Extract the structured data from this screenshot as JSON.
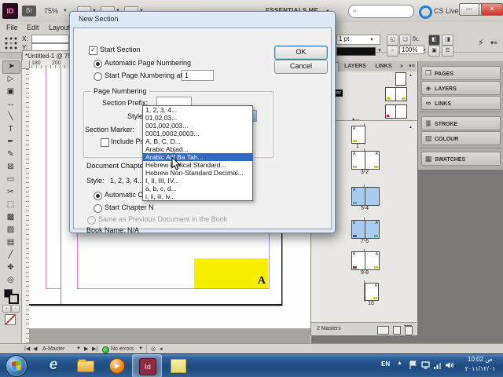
{
  "window": {
    "app_badge": "ID",
    "bridge_badge": "Br",
    "zoom_level": "75%",
    "workspace": "ESSENTIALS ME",
    "cs_live": "CS Live",
    "menus": [
      "File",
      "Edit",
      "Layout"
    ],
    "document_tab": "*Untitled-1 @ 75",
    "control": {
      "x_label": "X:",
      "y_label": "Y:",
      "stroke_weight": "1 pt",
      "fx_label": "fx.",
      "opacity": "100%"
    }
  },
  "toolbar": {
    "tools": [
      {
        "name": "selection-tool",
        "glyph": "➤"
      },
      {
        "name": "direct-selection-tool",
        "glyph": "▷"
      },
      {
        "name": "page-tool",
        "glyph": "▣"
      },
      {
        "name": "gap-tool",
        "glyph": "↔"
      },
      {
        "name": "line-tool",
        "glyph": "╲"
      },
      {
        "name": "type-tool",
        "glyph": "T"
      },
      {
        "name": "pen-tool",
        "glyph": "✒"
      },
      {
        "name": "pencil-tool",
        "glyph": "✎"
      },
      {
        "name": "frame-tool",
        "glyph": "⊠"
      },
      {
        "name": "rectangle-tool",
        "glyph": "▭"
      },
      {
        "name": "scissors-tool",
        "glyph": "✂"
      },
      {
        "name": "free-transform-tool",
        "glyph": "⬚"
      },
      {
        "name": "gradient-tool",
        "glyph": "▩"
      },
      {
        "name": "gradient-feather-tool",
        "glyph": "▨"
      },
      {
        "name": "note-tool",
        "glyph": "▤"
      },
      {
        "name": "eyedropper-tool",
        "glyph": "╱"
      },
      {
        "name": "hand-tool",
        "glyph": "✥"
      },
      {
        "name": "zoom-tool",
        "glyph": "◎"
      }
    ]
  },
  "ruler": {
    "h_numbers": [
      "180",
      "200"
    ]
  },
  "canvas": {
    "frame_letter": "A",
    "frame_color": "#f7ef00"
  },
  "dialog": {
    "title": "New Section",
    "ok": "OK",
    "cancel": "Cancel",
    "start_section": "Start Section",
    "automatic_page_numbering": "Automatic Page Numbering",
    "start_page_numbering_at": "Start Page Numbering at:",
    "start_page_value": "1",
    "page_numbering_group": "Page Numbering",
    "section_prefix": "Section Prefix:",
    "style_label": "Style:",
    "style_value": "1, 2, 3, 4...",
    "section_marker": "Section Marker:",
    "include_prefix": "Include Prefix",
    "document_chapter": "Document Chapter",
    "chapter_style_label": "Style:",
    "chapter_style_value": "1, 2, 3, 4...",
    "automatic_chapter": "Automatic Chap",
    "start_chapter": "Start Chapter N",
    "same_as_previous": "Same as Previous Document in the Book",
    "book_name": "Book Name: N/A"
  },
  "style_dropdown": {
    "highlight_color": "#316ac5",
    "selected": "Arabic Alif Ba Tah...",
    "items": [
      "1, 2, 3, 4...",
      "01,02,03...",
      "001,002,003...",
      "0001,0002,0003...",
      "A, B, C, D...",
      "Arabic Abjad...",
      "Arabic Alif Ba Tah...",
      "Hebrew Biblical Standard...",
      "Hebrew Non-Standard Decimal...",
      "I, II, III, IV...",
      "a, b, c, d...",
      "i, ii, iii, iv..."
    ]
  },
  "pages_panel": {
    "tabs": [
      "PAGES",
      "LAYERS",
      "LINKS"
    ],
    "master_fragment": "ter",
    "master_fragment2": "r",
    "masters_count": "2 Masters",
    "pages": [
      {
        "label": "1",
        "kind": "single-left",
        "selected": false,
        "letters": {
          "tl": "A"
        },
        "marks": [
          {
            "corner": "bl",
            "color": "#cfc938"
          }
        ]
      },
      {
        "label": "3-2",
        "kind": "spread",
        "selected": false,
        "letters": {
          "tl": "A",
          "tr": "A"
        },
        "marks": [
          {
            "corner": "bl",
            "color": "#cfc938"
          },
          {
            "corner": "br",
            "color": "#cfc938"
          }
        ]
      },
      {
        "label": "5-4",
        "kind": "spread",
        "selected": true,
        "letters": {
          "tl": "A"
        },
        "marks": [
          {
            "corner": "bl",
            "color": "#46b3a4"
          }
        ]
      },
      {
        "label": "7-6",
        "kind": "spread",
        "selected": true,
        "letters": {
          "tl": "B",
          "tr": "A"
        },
        "marks": [
          {
            "corner": "bl",
            "color": "#3a57a8"
          },
          {
            "corner": "br",
            "color": "#46b3a4"
          }
        ]
      },
      {
        "label": "9-8",
        "kind": "spread",
        "selected": false,
        "letters": {
          "tl": "B",
          "tr": "A"
        },
        "marks": [
          {
            "corner": "bl",
            "color": "#cc2222"
          },
          {
            "corner": "br",
            "color": "#cfc938"
          }
        ]
      },
      {
        "label": "10",
        "kind": "single-right",
        "selected": false,
        "letters": {
          "tr": "A"
        },
        "marks": [
          {
            "corner": "br",
            "color": "#cfc938"
          }
        ]
      }
    ]
  },
  "dock_panels": [
    {
      "label": "PAGES",
      "icon_name": "pages-icon",
      "glyph": "❐"
    },
    {
      "label": "LAYERS",
      "icon_name": "layers-icon",
      "glyph": "◈"
    },
    {
      "label": "LINKS",
      "icon_name": "links-icon",
      "glyph": "∞"
    },
    {
      "label": "STROKE",
      "icon_name": "stroke-icon",
      "glyph": "≣"
    },
    {
      "label": "COLOUR",
      "icon_name": "colour-icon",
      "glyph": "▧"
    },
    {
      "label": "SWATCHES",
      "icon_name": "swatches-icon",
      "glyph": "▦"
    }
  ],
  "status_bar": {
    "page_select": "A-Master",
    "preflight": "No errors"
  },
  "taskbar": {
    "language": "EN",
    "time": "10:02 ص",
    "date": "٢٠١١/١٢/٠١"
  },
  "colors": {
    "selection_blue": "#316ac5",
    "page_highlight": "#a8cbf0",
    "margin_pink": "#f07ad8",
    "guide_violet": "#a49bf2"
  }
}
